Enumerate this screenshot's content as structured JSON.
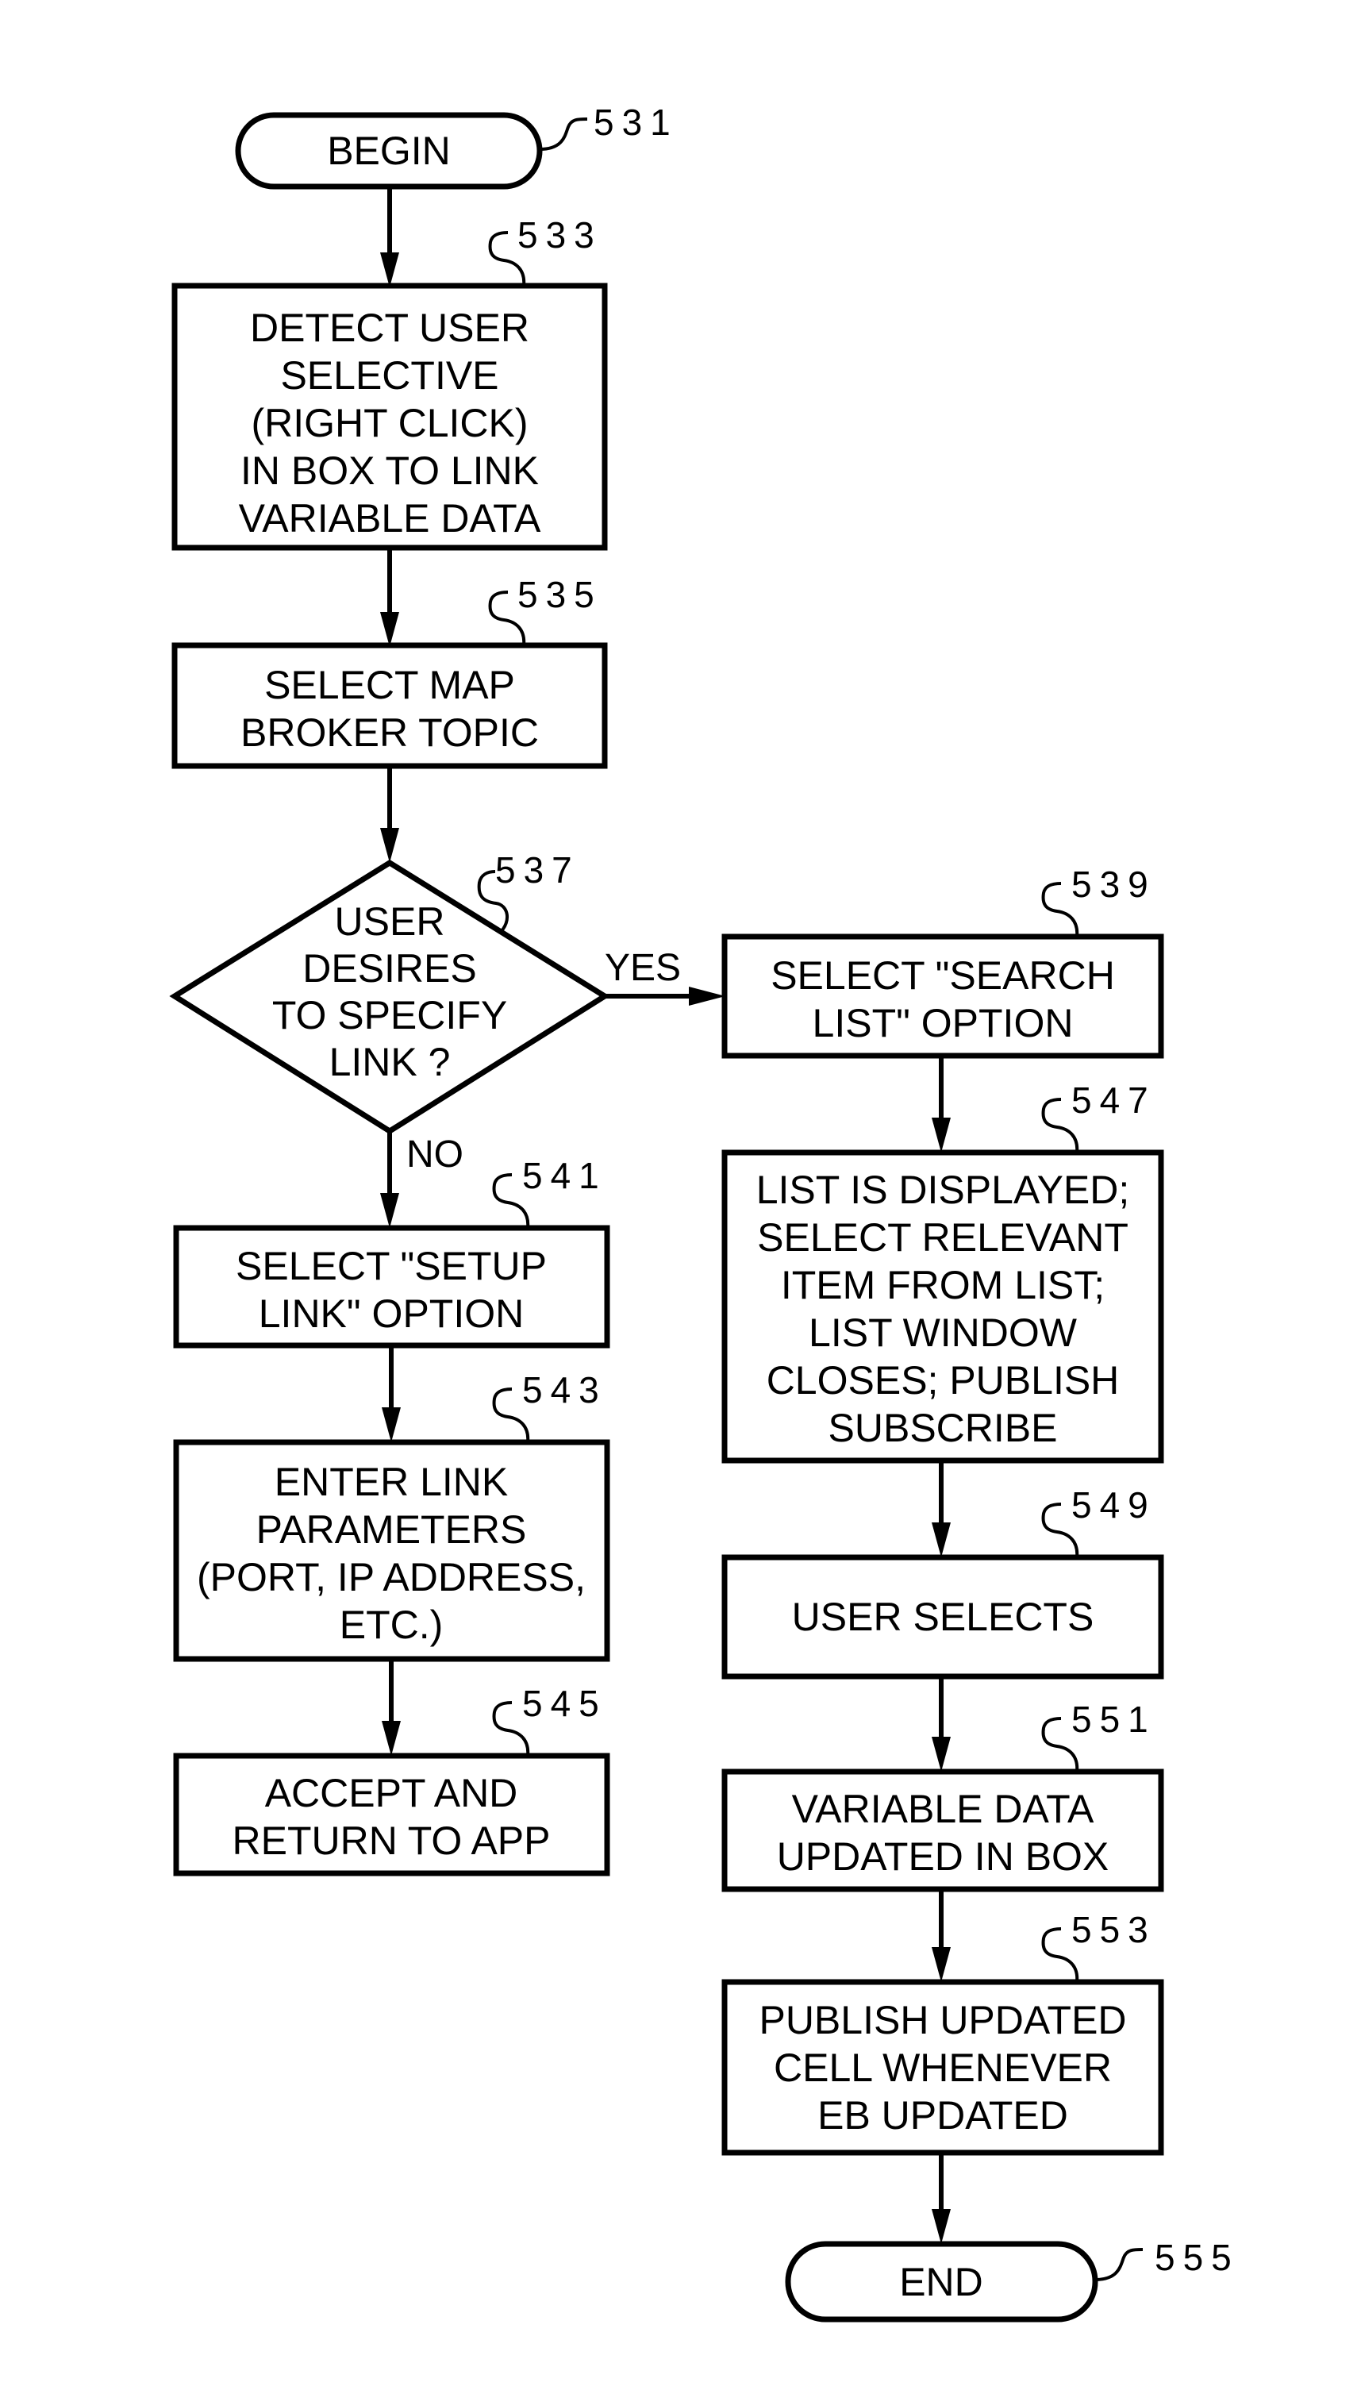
{
  "figure": {
    "nodes": {
      "begin": {
        "ref": "531",
        "lines": [
          "BEGIN"
        ]
      },
      "detect": {
        "ref": "533",
        "lines": [
          "DETECT USER",
          "SELECTIVE",
          "(RIGHT CLICK)",
          "IN BOX TO LINK",
          "VARIABLE DATA"
        ]
      },
      "select_map": {
        "ref": "535",
        "lines": [
          "SELECT MAP",
          "BROKER TOPIC"
        ]
      },
      "decision": {
        "ref": "537",
        "lines": [
          "USER",
          "DESIRES",
          "TO SPECIFY",
          "LINK ?"
        ]
      },
      "search_list": {
        "ref": "539",
        "lines": [
          "SELECT \"SEARCH",
          "LIST\" OPTION"
        ]
      },
      "setup_link": {
        "ref": "541",
        "lines": [
          "SELECT \"SETUP",
          "LINK\" OPTION"
        ]
      },
      "enter_params": {
        "ref": "543",
        "lines": [
          "ENTER LINK",
          "PARAMETERS",
          "(PORT, IP ADDRESS,",
          "ETC.)"
        ]
      },
      "accept": {
        "ref": "545",
        "lines": [
          "ACCEPT AND",
          "RETURN TO APP"
        ]
      },
      "list_displayed": {
        "ref": "547",
        "lines": [
          "LIST IS DISPLAYED;",
          "SELECT RELEVANT",
          "ITEM FROM LIST;",
          "LIST WINDOW",
          "CLOSES; PUBLISH",
          "SUBSCRIBE"
        ]
      },
      "user_selects": {
        "ref": "549",
        "lines": [
          "USER SELECTS"
        ]
      },
      "updated": {
        "ref": "551",
        "lines": [
          "VARIABLE DATA",
          "UPDATED IN BOX"
        ]
      },
      "publish": {
        "ref": "553",
        "lines": [
          "PUBLISH UPDATED",
          "CELL WHENEVER",
          "EB UPDATED"
        ]
      },
      "end": {
        "ref": "555",
        "lines": [
          "END"
        ]
      }
    },
    "edges": {
      "yes_label": "YES",
      "no_label": "NO"
    }
  }
}
